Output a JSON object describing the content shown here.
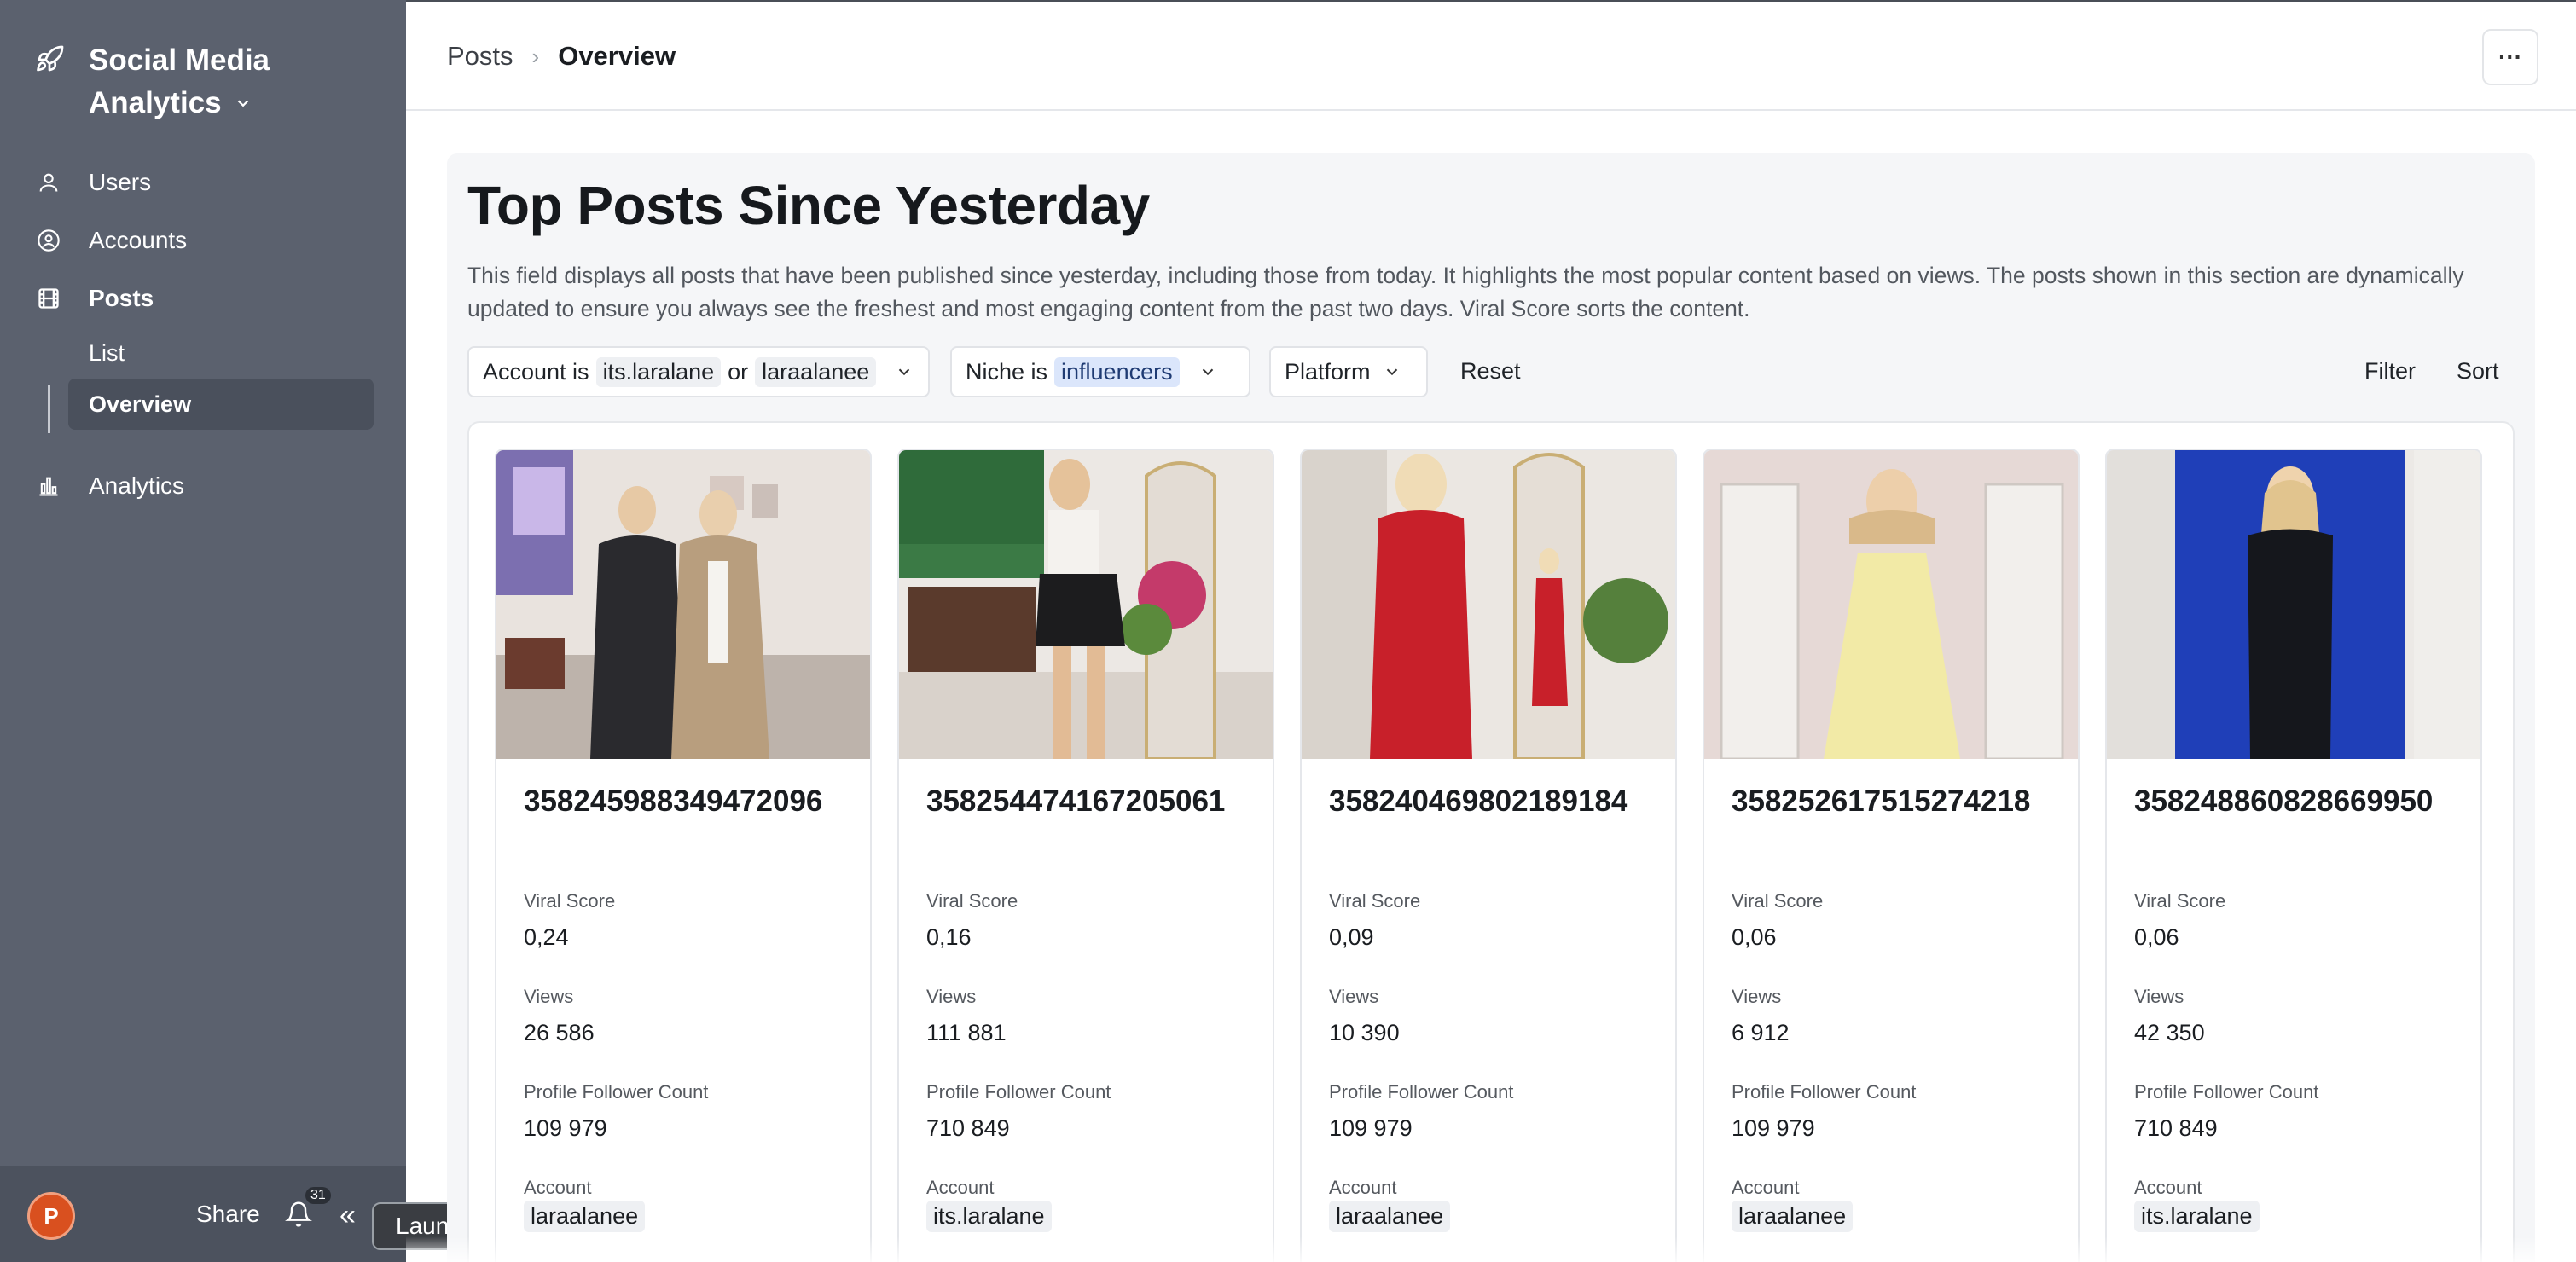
{
  "sidebar": {
    "brand_line1": "Social Media",
    "brand_line2": "Analytics",
    "items": [
      {
        "label": "Users"
      },
      {
        "label": "Accounts"
      },
      {
        "label": "Posts"
      },
      {
        "label": "Analytics"
      }
    ],
    "sub_items": [
      {
        "label": "List"
      },
      {
        "label": "Overview"
      }
    ],
    "footer": {
      "avatar_initial": "P",
      "share_label": "Share",
      "notification_count": "31",
      "tooltip": "Launchpad"
    }
  },
  "header": {
    "breadcrumb_parent": "Posts",
    "breadcrumb_current": "Overview",
    "more_label": "···"
  },
  "main": {
    "title": "Top Posts Since Yesterday",
    "description": "This field displays all posts that have been published since yesterday, including those from today. It highlights the most popular content based on views. The posts shown in this section are dynamically updated to ensure you always see the freshest and most engaging content from the past two days. Viral Score sorts the content.",
    "filters": {
      "account_prefix": "Account is",
      "account_value1": "its.laralane",
      "account_or": "or",
      "account_value2": "laraalanee",
      "niche_prefix": "Niche is",
      "niche_value": "influencers",
      "platform_label": "Platform",
      "reset_label": "Reset",
      "filter_label": "Filter",
      "sort_label": "Sort"
    },
    "field_labels": {
      "viral_score": "Viral Score",
      "views": "Views",
      "followers": "Profile Follower Count",
      "account": "Account"
    },
    "cards": [
      {
        "post_id": "358245988349472096",
        "viral_score": "0,24",
        "views": "26 586",
        "followers": "109 979",
        "account": "laraalanee"
      },
      {
        "post_id": "358254474167205061",
        "viral_score": "0,16",
        "views": "111 881",
        "followers": "710 849",
        "account": "its.laralane"
      },
      {
        "post_id": "358240469802189184",
        "viral_score": "0,09",
        "views": "10 390",
        "followers": "109 979",
        "account": "laraalanee"
      },
      {
        "post_id": "358252617515274218",
        "viral_score": "0,06",
        "views": "6 912",
        "followers": "109 979",
        "account": "laraalanee"
      },
      {
        "post_id": "358248860828669950",
        "viral_score": "0,06",
        "views": "42 350",
        "followers": "710 849",
        "account": "its.laralane"
      }
    ]
  },
  "colors": {
    "sidebar_bg": "#5b616e",
    "avatar_bg": "#d9501f",
    "niche_tag_bg": "#dbe6fb"
  }
}
